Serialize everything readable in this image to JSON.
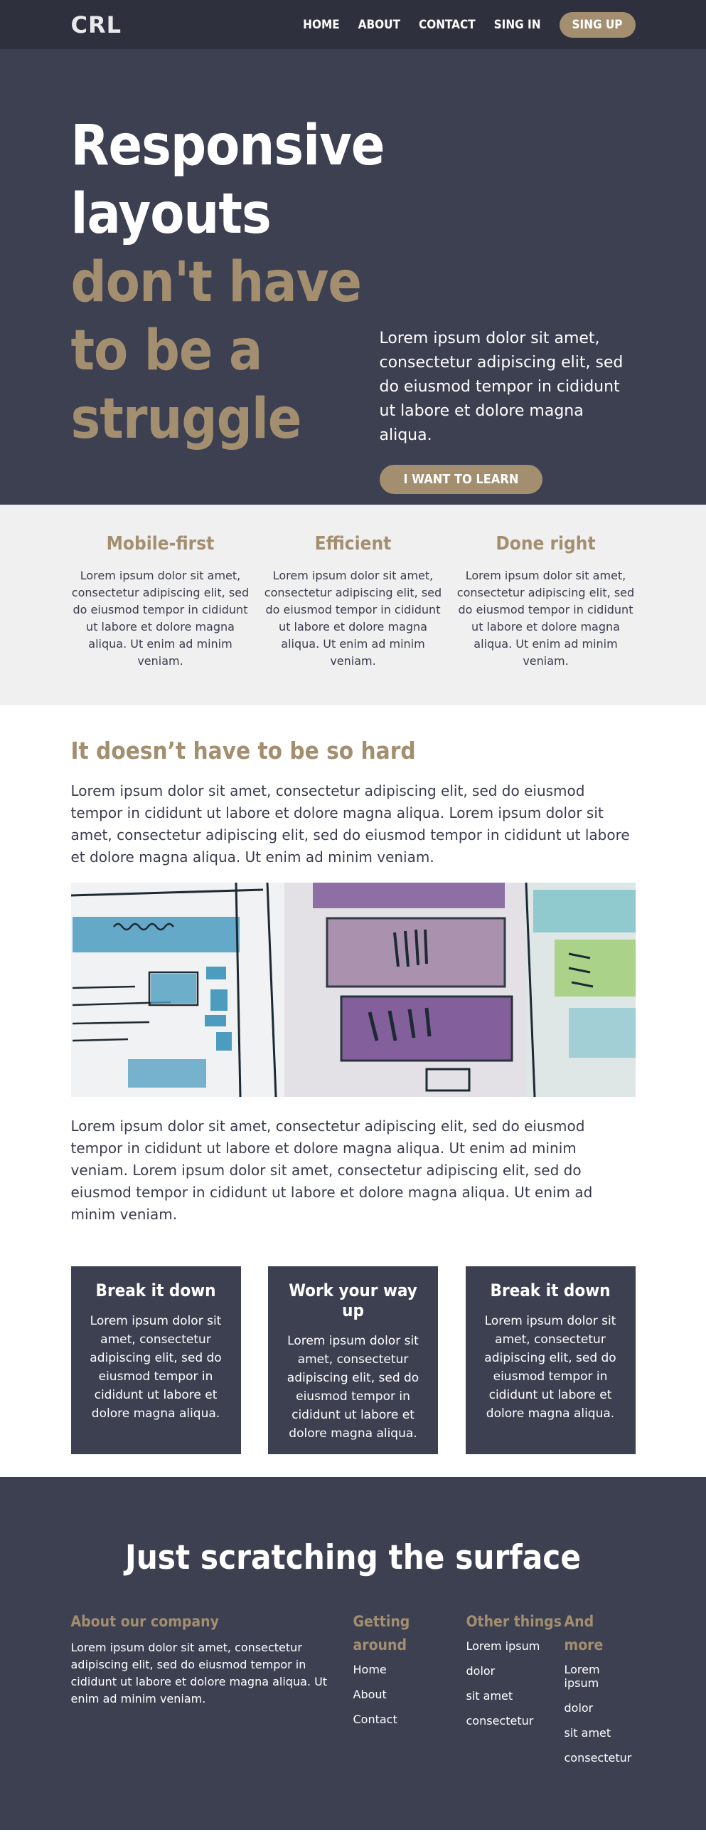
{
  "header": {
    "logo": "CRL",
    "nav": [
      "HOME",
      "ABOUT",
      "CONTACT",
      "SING IN"
    ],
    "signup": "SING UP"
  },
  "hero": {
    "title_white": [
      "Responsive",
      "layouts"
    ],
    "title_gold": [
      "don't have",
      "to be a",
      "struggle"
    ],
    "text": "Lorem ipsum dolor sit amet, consectetur adipiscing elit, sed do eiusmod tempor in cididunt ut labore et dolore magna aliqua.",
    "cta": "I WANT TO LEARN"
  },
  "features": [
    {
      "title": "Mobile-first",
      "text": "Lorem ipsum dolor sit amet, consectetur adipiscing elit, sed do eiusmod tempor in cididunt ut labore et dolore magna aliqua. Ut enim ad minim veniam."
    },
    {
      "title": "Efficient",
      "text": "Lorem ipsum dolor sit amet, consectetur adipiscing elit, sed do eiusmod tempor in cididunt ut labore et dolore magna aliqua. Ut enim ad minim veniam."
    },
    {
      "title": "Done right",
      "text": "Lorem ipsum dolor sit amet, consectetur adipiscing elit, sed do eiusmod tempor in cididunt ut labore et dolore magna aliqua. Ut enim ad minim veniam."
    }
  ],
  "article": {
    "heading": "It doesn’t have to be so hard",
    "para1": "Lorem ipsum dolor sit amet, consectetur adipiscing elit, sed do eiusmod tempor in cididunt ut labore et dolore magna aliqua. Lorem ipsum dolor sit amet, consectetur adipiscing elit, sed do eiusmod tempor in cididunt ut labore et dolore magna aliqua. Ut enim ad minim veniam.",
    "para2": "Lorem ipsum dolor sit amet, consectetur adipiscing elit, sed do eiusmod tempor in cididunt ut labore et dolore magna aliqua. Ut enim ad minim veniam. Lorem ipsum dolor sit amet, consectetur adipiscing elit, sed do eiusmod tempor in cididunt ut labore et dolore magna aliqua. Ut enim ad minim veniam."
  },
  "cards": [
    {
      "title": "Break it down",
      "text": "Lorem ipsum dolor sit amet, consectetur adipiscing elit, sed do eiusmod tempor in cididunt ut labore et dolore magna aliqua."
    },
    {
      "title": "Work your way up",
      "text": "Lorem ipsum dolor sit amet, consectetur adipiscing elit, sed do eiusmod tempor in cididunt ut labore et dolore magna aliqua."
    },
    {
      "title": "Break it down",
      "text": "Lorem ipsum dolor sit amet, consectetur adipiscing elit, sed do eiusmod tempor in cididunt ut labore et dolore magna aliqua."
    }
  ],
  "footer": {
    "heading": "Just scratching the surface",
    "about_title": "About our company",
    "about_text": "Lorem ipsum dolor sit amet, consectetur adipiscing elit, sed do eiusmod tempor in cididunt ut labore et dolore magna aliqua. Ut enim ad minim veniam.",
    "col2_title": "Getting around",
    "col2_links": [
      "Home",
      "About",
      "Contact"
    ],
    "col3_title": "Other things",
    "col3_links": [
      "Lorem ipsum",
      "dolor",
      "sit amet",
      "consectetur"
    ],
    "col4_title": "And more",
    "col4_links": [
      "Lorem ipsum",
      "dolor",
      "sit amet",
      "consectetur"
    ]
  },
  "colors": {
    "accent": "#a38f6f",
    "dark": "#3d4051",
    "topbar": "#2e303e",
    "light": "#f0f0f0"
  }
}
